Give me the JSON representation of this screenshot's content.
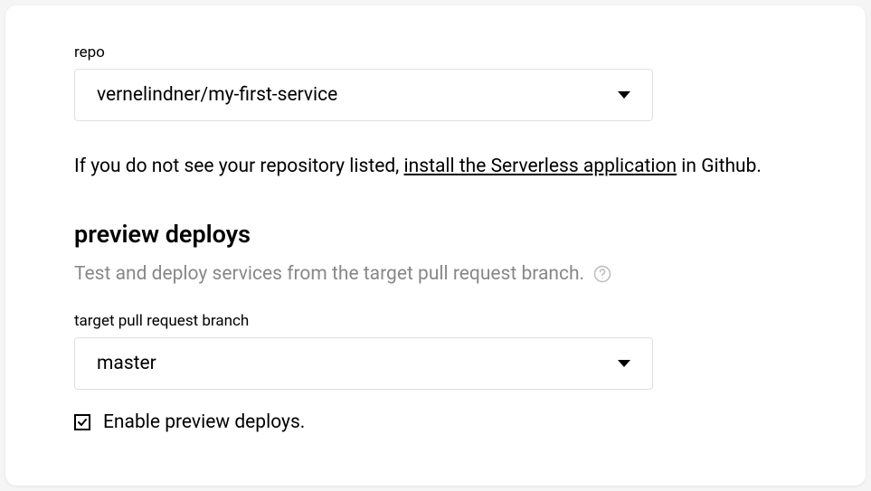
{
  "repo": {
    "label": "repo",
    "selected": "vernelindner/my-first-service"
  },
  "helpText": {
    "prefix": "If you do not see your repository listed, ",
    "link": "install the Serverless application",
    "suffix": " in Github."
  },
  "previewDeploys": {
    "heading": "preview deploys",
    "subtext": "Test and deploy services from the target pull request branch.",
    "branchLabel": "target pull request branch",
    "branchSelected": "master",
    "checkboxLabel": "Enable preview deploys.",
    "checkboxChecked": true
  }
}
